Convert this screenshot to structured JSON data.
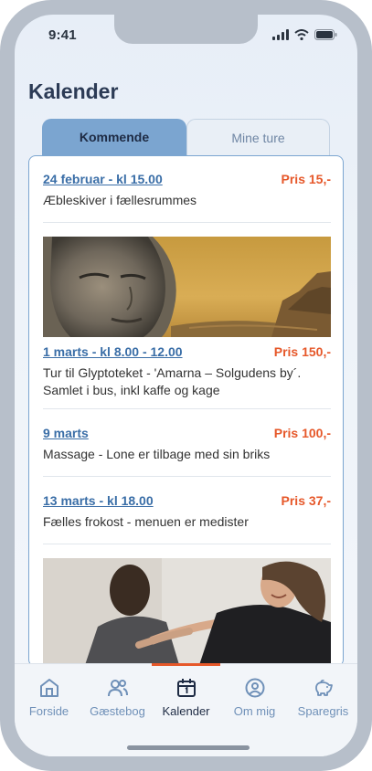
{
  "status": {
    "time": "9:41"
  },
  "page": {
    "title": "Kalender"
  },
  "tabs": [
    {
      "label": "Kommende",
      "active": true
    },
    {
      "label": "Mine ture",
      "active": false
    }
  ],
  "events": [
    {
      "date": "24 februar - kl 15.00",
      "price": "Pris 15,-",
      "description": "Æbleskiver i fællesrummes"
    },
    {
      "date": "1 marts - kl 8.00 - 12.00",
      "price": "Pris 150,-",
      "description": "Tur til Glyptoteket - 'Amarna – Solgudens by´. Samlet i bus, inkl kaffe og kage"
    },
    {
      "date": "9 marts",
      "price": "Pris 100,-",
      "description": "Massage - Lone er tilbage med sin briks"
    },
    {
      "date": "13 marts - kl 18.00",
      "price": "Pris 37,-",
      "description": "Fælles frokost - menuen er medister"
    }
  ],
  "nav": [
    {
      "label": "Forside",
      "icon": "home-icon",
      "active": false
    },
    {
      "label": "Gæstebog",
      "icon": "users-icon",
      "active": false
    },
    {
      "label": "Kalender",
      "icon": "calendar-icon",
      "active": true
    },
    {
      "label": "Om mig",
      "icon": "profile-icon",
      "active": false
    },
    {
      "label": "Sparegris",
      "icon": "piggy-bank-icon",
      "active": false
    }
  ],
  "colors": {
    "accent": "#7ba5d0",
    "link": "#3a6ea7",
    "price": "#e6582a",
    "title": "#2c3b55"
  }
}
